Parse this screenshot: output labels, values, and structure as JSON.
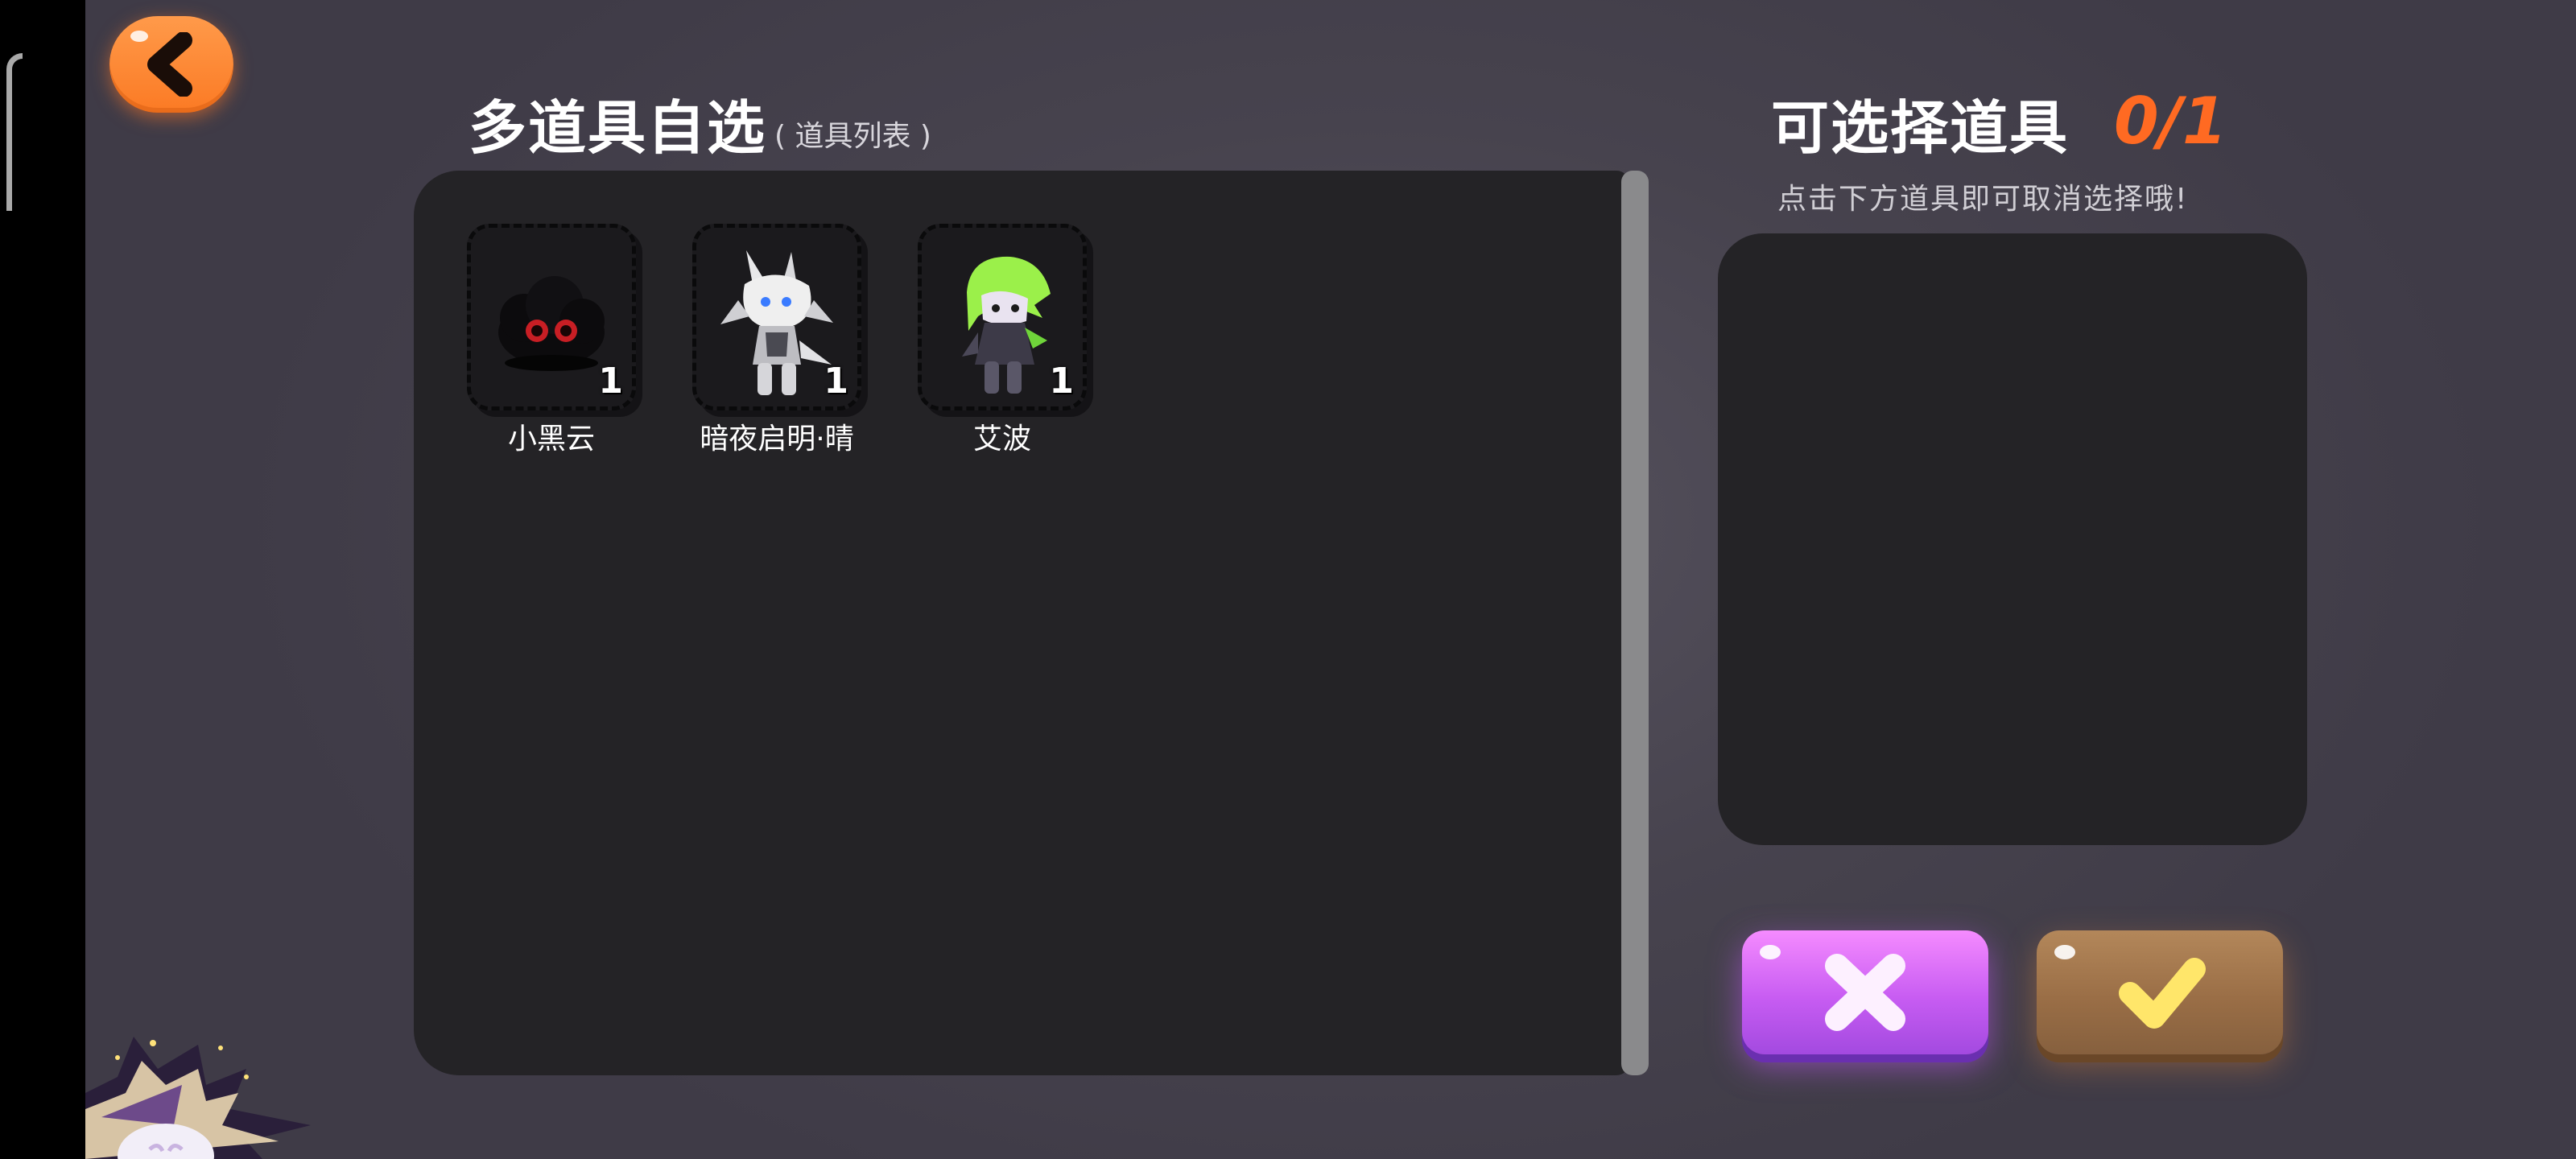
{
  "left_panel": {
    "title": "多道具自选",
    "subtitle": "( 道具列表 )"
  },
  "items": [
    {
      "name": "小黑云",
      "count": "1",
      "icon": "black-cloud-icon"
    },
    {
      "name": "暗夜启明·晴",
      "count": "1",
      "icon": "white-wolf-character-icon"
    },
    {
      "name": "艾波",
      "count": "1",
      "icon": "green-hair-character-icon"
    }
  ],
  "right_panel": {
    "title": "可选择道具",
    "selected_count": "0/1",
    "hint": "点击下方道具即可取消选择哦!"
  },
  "buttons": {
    "cancel_icon": "x-icon",
    "confirm_icon": "check-icon"
  },
  "colors": {
    "accent_orange": "#ff6a22",
    "cancel_purple": "#c75cf2",
    "confirm_brown": "#9a6e46",
    "panel_bg": "#242326"
  }
}
